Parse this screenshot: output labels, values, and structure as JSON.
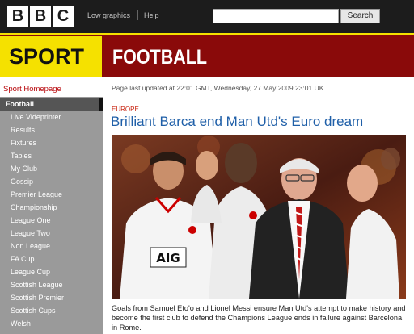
{
  "header": {
    "logo_letters": [
      "B",
      "B",
      "C"
    ],
    "low_graphics": "Low graphics",
    "help": "Help",
    "search_placeholder": "",
    "search_button": "Search"
  },
  "banner": {
    "sport": "SPORT",
    "section": "FOOTBALL"
  },
  "sidebar": {
    "home": "Sport Homepage",
    "items": [
      {
        "label": "Football",
        "active": true
      },
      {
        "label": "Live Videprinter"
      },
      {
        "label": "Results"
      },
      {
        "label": "Fixtures"
      },
      {
        "label": "Tables"
      },
      {
        "label": "My Club"
      },
      {
        "label": "Gossip"
      },
      {
        "label": "Premier League"
      },
      {
        "label": "Championship"
      },
      {
        "label": "League One"
      },
      {
        "label": "League Two"
      },
      {
        "label": "Non League"
      },
      {
        "label": "FA Cup"
      },
      {
        "label": "League Cup"
      },
      {
        "label": "Scottish League"
      },
      {
        "label": "Scottish Premier"
      },
      {
        "label": "Scottish Cups"
      },
      {
        "label": "Welsh"
      }
    ]
  },
  "article": {
    "updated": "Page last updated at 22:01 GMT, Wednesday, 27 May 2009 23:01 UK",
    "section": "EUROPE",
    "headline": "Brilliant Barca end Man Utd's Euro dream",
    "shirt_sponsor": "AIG",
    "caption": "Goals from Samuel Eto'o and Lionel Messi ensure Man Utd's attempt to make history and become the first club to defend the Champions League ends in failure against Barcelona in Rome."
  },
  "colors": {
    "topbar": "#1c1c1c",
    "sport_yellow": "#f5e100",
    "banner_red": "#8a0a0a",
    "headline_blue": "#1f5fa8",
    "section_red": "#c8200c",
    "sidebar_grey": "#9a9a9a"
  }
}
